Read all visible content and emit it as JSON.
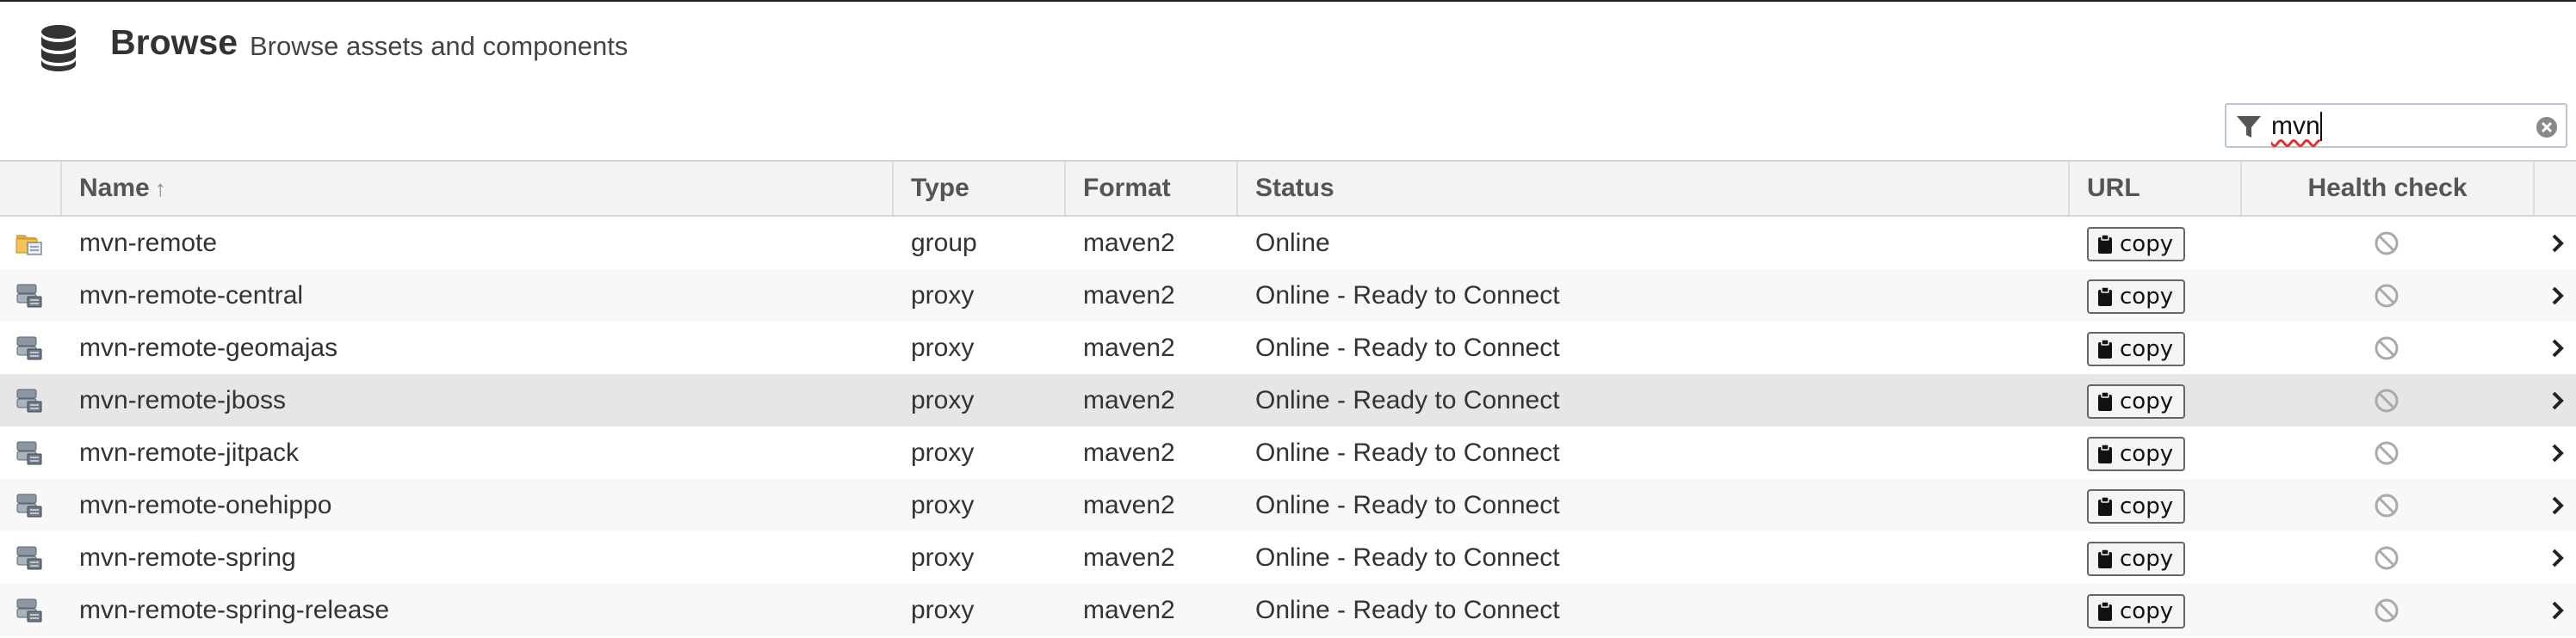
{
  "header": {
    "title": "Browse",
    "subtitle": "Browse assets and components",
    "icon": "database-icon"
  },
  "filter": {
    "value": "mvn",
    "icon": "filter-icon",
    "clear_icon": "clear-icon"
  },
  "columns": {
    "name": "Name",
    "type": "Type",
    "format": "Format",
    "status": "Status",
    "url": "URL",
    "health": "Health check",
    "sort_indicator": "↑"
  },
  "copy_label": "copy",
  "rows": [
    {
      "icon": "group-folder-icon",
      "name": "mvn-remote",
      "type": "group",
      "format": "maven2",
      "status": "Online"
    },
    {
      "icon": "proxy-server-icon",
      "name": "mvn-remote-central",
      "type": "proxy",
      "format": "maven2",
      "status": "Online - Ready to Connect"
    },
    {
      "icon": "proxy-server-icon",
      "name": "mvn-remote-geomajas",
      "type": "proxy",
      "format": "maven2",
      "status": "Online - Ready to Connect"
    },
    {
      "icon": "proxy-server-icon",
      "name": "mvn-remote-jboss",
      "type": "proxy",
      "format": "maven2",
      "status": "Online - Ready to Connect"
    },
    {
      "icon": "proxy-server-icon",
      "name": "mvn-remote-jitpack",
      "type": "proxy",
      "format": "maven2",
      "status": "Online - Ready to Connect"
    },
    {
      "icon": "proxy-server-icon",
      "name": "mvn-remote-onehippo",
      "type": "proxy",
      "format": "maven2",
      "status": "Online - Ready to Connect"
    },
    {
      "icon": "proxy-server-icon",
      "name": "mvn-remote-spring",
      "type": "proxy",
      "format": "maven2",
      "status": "Online - Ready to Connect"
    },
    {
      "icon": "proxy-server-icon",
      "name": "mvn-remote-spring-release",
      "type": "proxy",
      "format": "maven2",
      "status": "Online - Ready to Connect"
    }
  ],
  "selected_row_index": 3,
  "colors": {
    "header_bg": "#f3f3f3",
    "alt_row_bg": "#f8f8f8",
    "selected_row_bg": "#e6e6e6",
    "filter_border": "#b8c7d8"
  }
}
